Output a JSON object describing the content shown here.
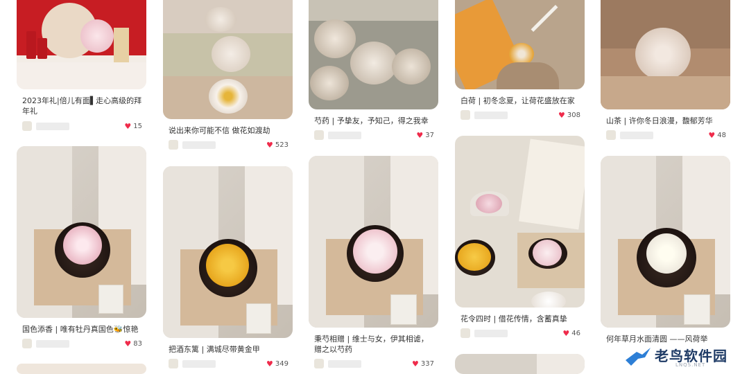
{
  "cards": [
    {
      "title": "2023年礼|倍儿有面▌走心高级的拜年礼",
      "likes": "15"
    },
    {
      "title": "国色添香 | 唯有牡丹真国色🐝惊艳",
      "likes": "83"
    },
    {
      "title": "说出来你可能不信 做花如渡劫",
      "likes": "523"
    },
    {
      "title": "把酒东篱 | 满城尽带黄金甲",
      "likes": "349"
    },
    {
      "title": "芍药 | 予挚友，予知己，得之我幸",
      "likes": "37"
    },
    {
      "title": "秉芍相赠 | 维士与女，伊其相谑，赠之以芍药",
      "likes": "337"
    },
    {
      "title": "白荷 | 初冬念夏，让荷花盛放在家",
      "likes": "308"
    },
    {
      "title": "花令四时 | 借花传情，含蓄真挚",
      "likes": "46"
    },
    {
      "title": "山茶 | 许你冬日浪漫，馥郁芳华",
      "likes": "48"
    },
    {
      "title": "何年草月水面清圆 ——风荷举"
    }
  ],
  "watermark": {
    "name": "老鸟软件园",
    "domain": "LNQS.NET"
  },
  "colors": {
    "heart": "#ef2b4b",
    "pink_flower": "#f0c6cf",
    "yellow_flower": "#e9a41c",
    "white_flower": "#ffffff"
  }
}
